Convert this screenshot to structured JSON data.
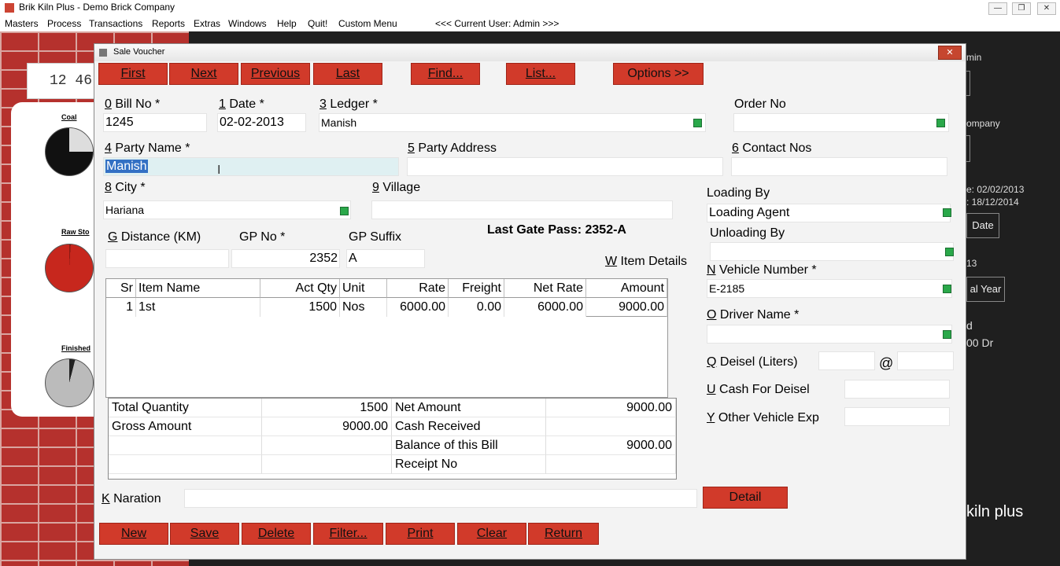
{
  "app": {
    "title": "Brik Kiln Plus - Demo Brick Company",
    "min_label": "—",
    "max_label": "❐",
    "close_label": "✕"
  },
  "menu": {
    "items": [
      "Masters",
      "Process",
      "Transactions",
      "Reports",
      "Extras",
      "Windows",
      "Help",
      "Quit!",
      "Custom Menu"
    ],
    "user": "<<<  Current User: Admin >>>"
  },
  "background": {
    "clock": "12 46",
    "gauges": [
      "Coal",
      "Raw Sto",
      "Finished"
    ],
    "right_texts": [
      "min",
      "ompany",
      "e: 02/02/2013",
      ": 18/12/2014",
      "13",
      "d",
      "00 Dr",
      "kiln plus"
    ],
    "right_buttons": [
      "Date",
      "al Year"
    ]
  },
  "dialog": {
    "title": "Sale Voucher",
    "close": "✕",
    "nav_buttons": [
      "First",
      "Next",
      "Previous",
      "Last",
      "Find...",
      "List...",
      "Options >>"
    ],
    "labels": {
      "bill_no": {
        "key": "0",
        "text": " Bill No *"
      },
      "date": {
        "key": "1",
        "text": " Date *"
      },
      "ledger": {
        "key": "3",
        "text": " Ledger *"
      },
      "order_no": "Order No",
      "party_name": {
        "key": "4",
        "text": " Party Name *"
      },
      "party_address": {
        "key": "5",
        "text": " Party Address"
      },
      "contact_nos": {
        "key": "6",
        "text": " Contact Nos"
      },
      "city": {
        "key": "8",
        "text": " City *"
      },
      "village": {
        "key": "9",
        "text": " Village"
      },
      "loading_by": "Loading By",
      "unloading_by": "Unloading By",
      "distance": {
        "key": "G",
        "text": " Distance (KM)"
      },
      "gp_no": "GP No *",
      "gp_suffix": "GP Suffix",
      "last_gate_pass": "Last Gate Pass: 2352-A",
      "item_details": {
        "key": "W",
        "text": "  Item Details"
      },
      "vehicle_number": {
        "key": "N",
        "text": " Vehicle Number *"
      },
      "driver_name": {
        "key": "O",
        "text": " Driver Name *"
      },
      "deisel": {
        "key": "Q",
        "text": " Deisel (Liters)"
      },
      "at": "@",
      "cash_for_deisel": {
        "key": "U",
        "text": " Cash For Deisel"
      },
      "other_vehicle_exp": {
        "key": "Y",
        "text": " Other Vehicle Exp"
      },
      "naration": {
        "key": "K",
        "text": " Naration"
      }
    },
    "values": {
      "bill_no": "1245",
      "date": "02-02-2013",
      "ledger": "Manish",
      "order_no": "",
      "party_name": "Manish",
      "party_address": "",
      "contact_nos": "",
      "city": "Hariana",
      "village": "",
      "loading_by": "Loading Agent",
      "unloading_by": "",
      "distance": "",
      "gp_no": "2352",
      "gp_suffix": "A",
      "vehicle_number": "E-2185",
      "driver_name": "",
      "deisel": "",
      "deisel_rate": "",
      "cash_for_deisel": "",
      "other_vehicle_exp": "",
      "naration": ""
    },
    "grid": {
      "headers": [
        "Sr",
        "Item Name",
        "Act Qty",
        "Unit",
        "Rate",
        "Freight",
        "Net Rate",
        "Amount"
      ],
      "rows": [
        [
          "1",
          "1st",
          "1500",
          "Nos",
          "6000.00",
          "0.00",
          "6000.00",
          "9000.00"
        ]
      ]
    },
    "totals": {
      "total_quantity_label": "Total Quantity",
      "total_quantity": "1500",
      "gross_amount_label": "Gross Amount",
      "gross_amount": "9000.00",
      "net_amount_label": "Net Amount",
      "net_amount": "9000.00",
      "cash_received_label": "Cash Received",
      "cash_received": "",
      "balance_label": "Balance of this Bill",
      "balance": "9000.00",
      "receipt_no_label": "Receipt No",
      "receipt_no": ""
    },
    "detail_button": "Detail",
    "action_buttons": [
      "New",
      "Save",
      "Delete",
      "Filter...",
      "Print",
      "Clear",
      "Return"
    ]
  }
}
